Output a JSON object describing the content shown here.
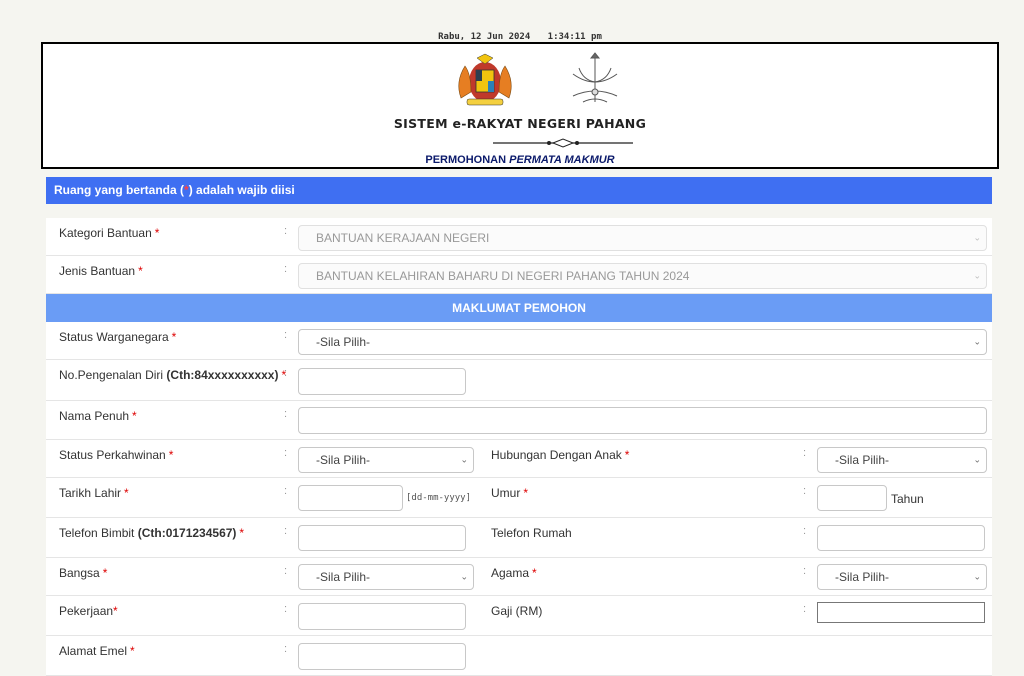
{
  "header": {
    "day_date": "Rabu, 12 Jun 2024",
    "time": "1:34:11 pm",
    "system_title": "SISTEM e-RAKYAT NEGERI PAHANG",
    "subtitle_prefix": "PERMOHONAN ",
    "subtitle_italic": "PERMATA MAKMUR"
  },
  "notice": {
    "before": "Ruang yang bertanda (",
    "star": "*",
    "after": ") adalah wajib diisi"
  },
  "form": {
    "kategori": {
      "label": "Kategori Bantuan",
      "value": "BANTUAN KERAJAAN NEGERI"
    },
    "jenis": {
      "label": "Jenis Bantuan",
      "value": "BANTUAN KELAHIRAN BAHARU DI NEGERI PAHANG TAHUN 2024"
    },
    "section_pemohon": "MAKLUMAT PEMOHON",
    "status_warganegara": {
      "label": "Status Warganegara",
      "value": "-Sila Pilih-"
    },
    "no_kp": {
      "label": "No.Pengenalan Diri ",
      "label_bold": "(Cth:84xxxxxxxxxx)",
      "value": ""
    },
    "nama": {
      "label": "Nama Penuh",
      "value": ""
    },
    "status_kahwin": {
      "label": "Status Perkahwinan",
      "value": "-Sila Pilih-"
    },
    "hubungan": {
      "label": "Hubungan Dengan Anak",
      "value": "-Sila Pilih-"
    },
    "tarikh_lahir": {
      "label": "Tarikh Lahir",
      "hint": "[dd-mm-yyyy]",
      "value": ""
    },
    "umur": {
      "label": "Umur",
      "unit": "Tahun",
      "value": ""
    },
    "telefon_bimbit": {
      "label": "Telefon Bimbit ",
      "label_bold": "(Cth:0171234567)",
      "value": ""
    },
    "telefon_rumah": {
      "label": "Telefon Rumah",
      "value": ""
    },
    "bangsa": {
      "label": "Bangsa",
      "value": "-Sila Pilih-"
    },
    "agama": {
      "label": "Agama",
      "value": "-Sila Pilih-"
    },
    "pekerjaan": {
      "label": "Pekerjaan",
      "value": ""
    },
    "gaji": {
      "label": "Gaji (RM)",
      "value": ""
    },
    "email": {
      "label": "Alamat Emel"
    }
  },
  "symbols": {
    "required": "*",
    "colon": ":"
  },
  "colors": {
    "notice_bar": "#3f6ff2",
    "section_bar": "#6a9cf5",
    "required": "#dd0000",
    "subtitle": "#0b1a6b"
  },
  "icons": [
    "malaysia-coat-of-arms-icon",
    "pahang-crest-icon",
    "chevron-down-icon"
  ]
}
